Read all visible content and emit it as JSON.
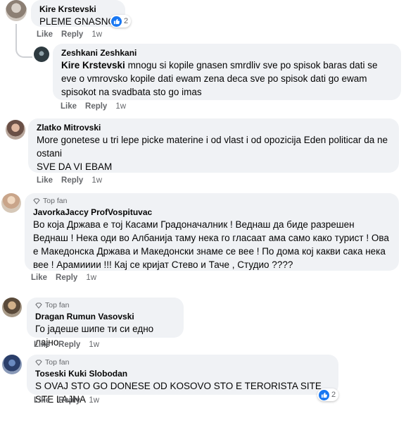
{
  "comments": [
    {
      "author": "Kire Krstevski",
      "text": "PLEME GNASNO",
      "reactions": "2",
      "like": "Like",
      "reply": "Reply",
      "time": "1w"
    },
    {
      "author": "Zeshkani Zeshkani",
      "tag": "Kire Krstevski",
      "text": " mnogu si kopile gnasen smrdliv sve po spisok baras dati se eve o vmrovsko kopile dati ewam zena deca sve po spisok dati go ewam spisokot na svadbata sto go imas",
      "like": "Like",
      "reply": "Reply",
      "time": "1w"
    },
    {
      "author": "Zlatko Mitrovski",
      "text": "More gonetese u tri lepe picke materine i od vlast i od opozicija Eden politicar da ne ostani\nSVE DA VI EBAM",
      "like": "Like",
      "reply": "Reply",
      "time": "1w"
    },
    {
      "badge": "Top fan",
      "author": "JavorkaJaccy ProfVospituvac",
      "text": "Во која Држава е тој Касами Градоначалник ! Веднаш да биде разрешен Веднаш ! Нека оди во Албанија таму нека го гласаат ама само како турист ! Ова е Македонска Држава и Македонски знаме се вее ! По дома кој какви сака нека вее ! Арамииии !!! Кај се кријат Стево и Таче , Студио ????",
      "like": "Like",
      "reply": "Reply",
      "time": "1w"
    },
    {
      "badge": "Top fan",
      "author": "Dragan Rumun Vasovski",
      "text": "Го јадеше шипе ти си едно лајно",
      "like": "Like",
      "reply": "Reply",
      "time": "1w"
    },
    {
      "badge": "Top fan",
      "author": "Toseski Kuki Slobodan",
      "text": "S OVAJ STO GO DONESE OD KOSOVO STO E TERORISTA SITE STE LAJNA",
      "reactions": "2",
      "like": "Like",
      "reply": "Reply",
      "time": "1w"
    }
  ]
}
